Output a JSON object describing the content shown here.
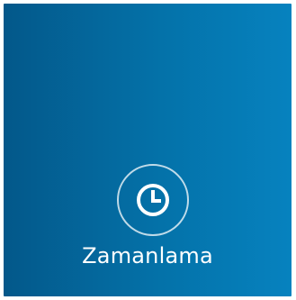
{
  "tile": {
    "label": "Zamanlama",
    "icon": "clock-icon",
    "colors": {
      "gradient_start": "#03588a",
      "gradient_end": "#0682bf",
      "foreground": "#ffffff"
    }
  }
}
